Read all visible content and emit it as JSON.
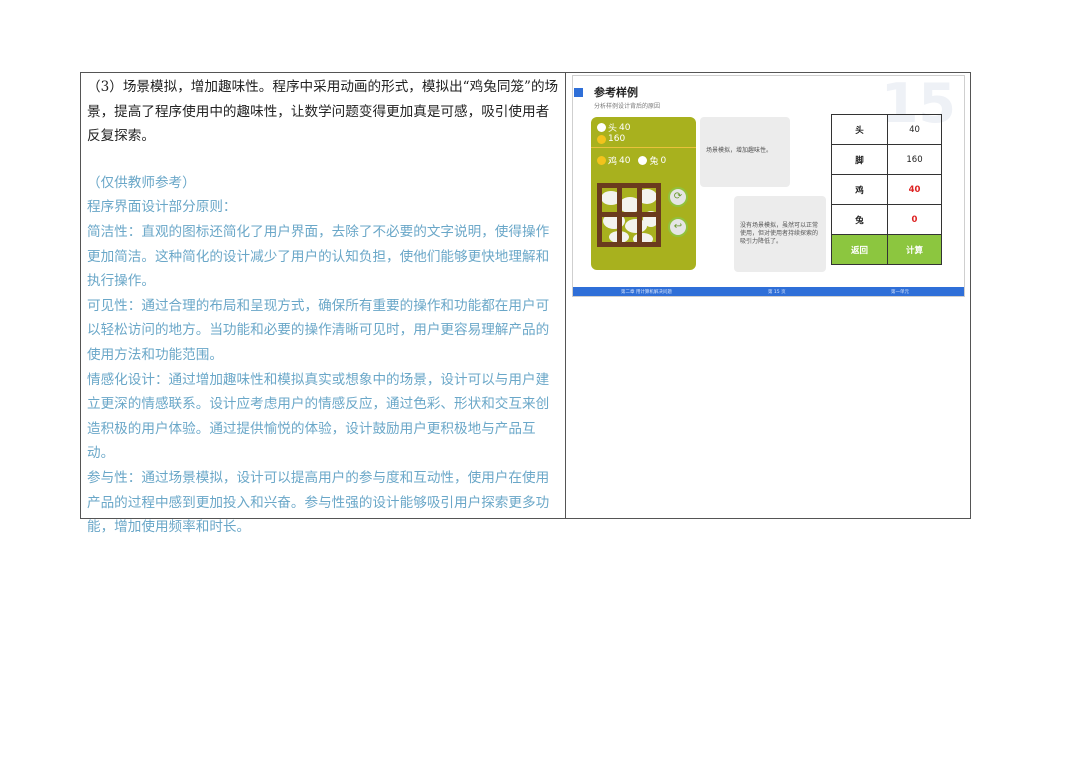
{
  "left": {
    "intro": "（3）场景模拟，增加趣味性。程序中采用动画的形式，模拟出“鸡兔同笼”的场景，提高了程序使用中的趣味性，让数学问题变得更加真是可感，吸引使用者反复探索。",
    "note_header": "（仅供教师参考）",
    "principles_title": "程序界面设计部分原则：",
    "p_simplicity": "简洁性：直观的图标还简化了用户界面，去除了不必要的文字说明，使得操作更加简洁。这种简化的设计减少了用户的认知负担，使他们能够更快地理解和执行操作。",
    "p_visibility": "可见性：通过合理的布局和呈现方式，确保所有重要的操作和功能都在用户可以轻松访问的地方。当功能和必要的操作清晰可见时，用户更容易理解产品的使用方法和功能范围。",
    "p_emotional": "情感化设计：通过增加趣味性和模拟真实或想象中的场景，设计可以与用户建立更深的情感联系。设计应考虑用户的情感反应，通过色彩、形状和交互来创造积极的用户体验。通过提供愉悦的体验，设计鼓励用户更积极地与产品互动。",
    "p_participation": "参与性：通过场景模拟，设计可以提高用户的参与度和互动性，使用户在使用产品的过程中感到更加投入和兴奋。参与性强的设计能够吸引用户探索更多功能，增加使用频率和时长。"
  },
  "slide": {
    "title": "参考样例",
    "subtitle": "分析样例设计背后的原因",
    "number": "15",
    "game": {
      "head_label": "头",
      "head_value": "40",
      "feet_value": "160",
      "chicken_label": "鸡",
      "chicken_value": "40",
      "rabbit_label": "兔",
      "rabbit_value": "0"
    },
    "note1": "场景模拟，增加趣味性。",
    "note2": "没有场景模拟，虽然可以正常使用，但对使用者持续探索的吸引力降低了。",
    "calc": {
      "head_label": "头",
      "head_value": "40",
      "feet_label": "脚",
      "feet_value": "160",
      "chicken_label": "鸡",
      "chicken_value": "40",
      "rabbit_label": "兔",
      "rabbit_value": "0",
      "back_label": "返回",
      "calc_label": "计算"
    },
    "footer": {
      "left": "第二章 用计算机解决问题",
      "middle": "第 15 页",
      "right": "第一单元"
    },
    "colors": {
      "accent": "#2f6fd8",
      "button": "#8cc63f",
      "alert": "#d22222",
      "game_bg": "#a8b11e"
    }
  }
}
